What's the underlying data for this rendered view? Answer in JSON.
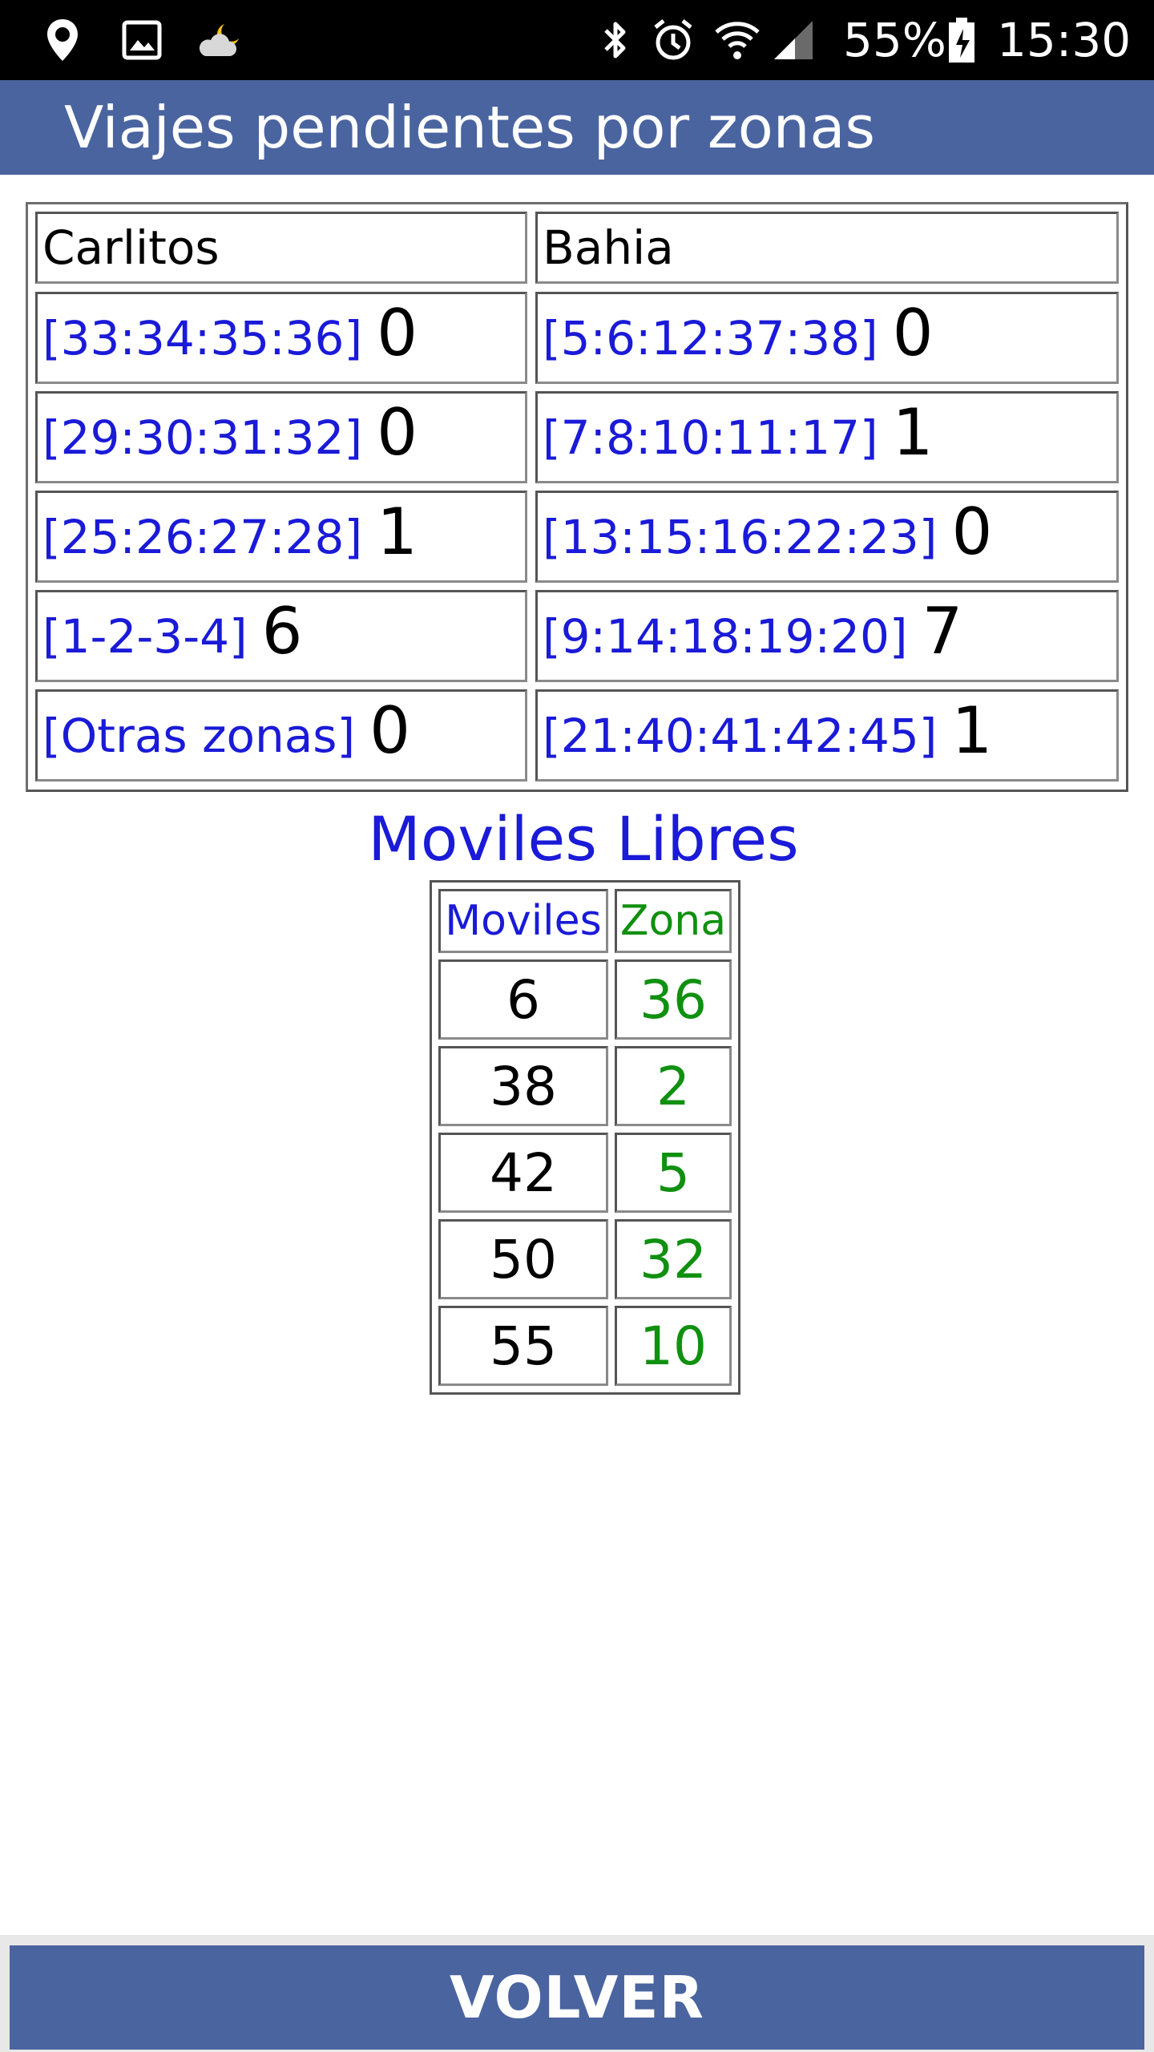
{
  "status_bar": {
    "icons_left": [
      "location-icon",
      "gallery-icon",
      "weather-night-cloud-icon"
    ],
    "icons_right": [
      "bluetooth-icon",
      "alarm-icon",
      "wifi-icon",
      "signal-icon",
      "battery-charging-icon"
    ],
    "battery": "55%",
    "time": "15:30"
  },
  "header": {
    "title": "Viajes pendientes por zonas"
  },
  "zones": {
    "columns": [
      "Carlitos",
      "Bahia"
    ],
    "rows": [
      [
        {
          "label": "[33:34:35:36]",
          "count": "0"
        },
        {
          "label": "[5:6:12:37:38]",
          "count": "0"
        }
      ],
      [
        {
          "label": "[29:30:31:32]",
          "count": "0"
        },
        {
          "label": "[7:8:10:11:17]",
          "count": "1"
        }
      ],
      [
        {
          "label": "[25:26:27:28]",
          "count": "1"
        },
        {
          "label": "[13:15:16:22:23]",
          "count": "0"
        }
      ],
      [
        {
          "label": "[1-2-3-4]",
          "count": "6"
        },
        {
          "label": "[9:14:18:19:20]",
          "count": "7"
        }
      ],
      [
        {
          "label": "[Otras zonas]",
          "count": "0"
        },
        {
          "label": "[21:40:41:42:45]",
          "count": "1"
        }
      ]
    ]
  },
  "moviles": {
    "title": "Moviles Libres",
    "headers": [
      "Moviles",
      "Zona"
    ],
    "rows": [
      [
        "6",
        "36"
      ],
      [
        "38",
        "2"
      ],
      [
        "42",
        "5"
      ],
      [
        "50",
        "32"
      ],
      [
        "55",
        "10"
      ]
    ]
  },
  "footer": {
    "button_label": "VOLVER"
  },
  "colors": {
    "app_bar": "#4a64a0",
    "link_blue": "#1a1ad8",
    "zone_green": "#109010"
  }
}
